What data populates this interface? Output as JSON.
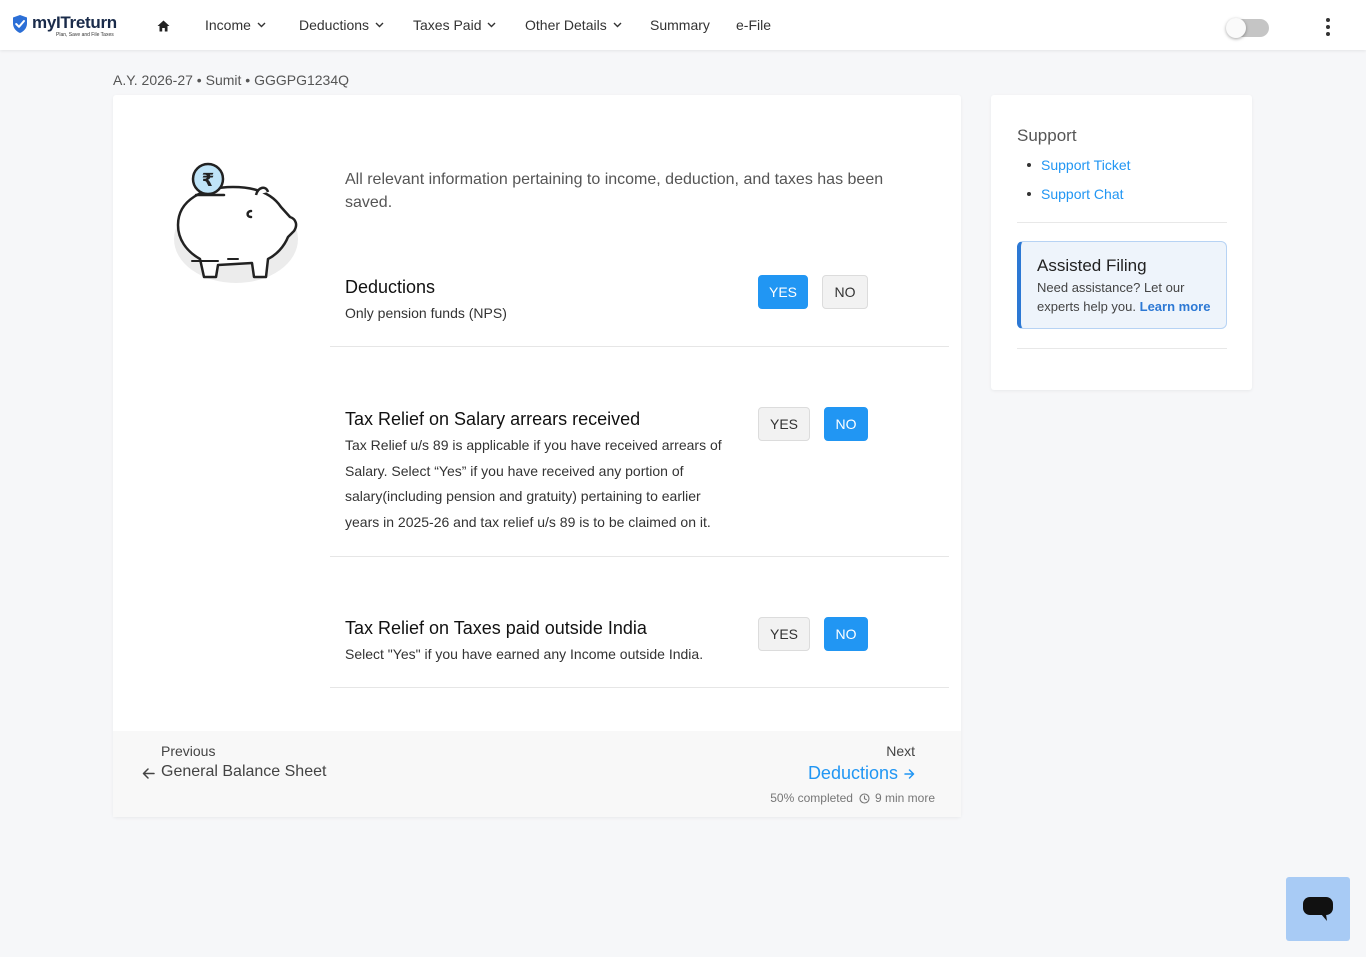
{
  "brand": {
    "name": "myITreturn",
    "tagline": "Plan, Save and File Taxes",
    "accent": "#2196f3"
  },
  "nav": {
    "home_icon": "home-icon",
    "items": [
      {
        "label": "Income",
        "dropdown": true
      },
      {
        "label": "Deductions",
        "dropdown": true
      },
      {
        "label": "Taxes Paid",
        "dropdown": true
      },
      {
        "label": "Other Details",
        "dropdown": true
      },
      {
        "label": "Summary",
        "dropdown": false
      },
      {
        "label": "e-File",
        "dropdown": false
      }
    ],
    "toggle_on": false,
    "menu_icon": "more-vertical-icon"
  },
  "breadcrumb": "A.Y. 2026-27 • Sumit • GGGPG1234Q",
  "main": {
    "saved_message": "All relevant information pertaining to income, deduction, and taxes has been saved.",
    "sections": [
      {
        "title": "Deductions",
        "description": "Only pension funds (NPS)",
        "yes_label": "YES",
        "no_label": "NO",
        "selected": "yes"
      },
      {
        "title": "Tax Relief on Salary arrears received",
        "description": "Tax Relief u/s 89 is applicable if you have received arrears of Salary. Select “Yes” if you have received any portion of salary(including pension and gratuity) pertaining to earlier years in 2025-26 and tax relief u/s 89 is to be claimed on it.",
        "yes_label": "YES",
        "no_label": "NO",
        "selected": "no"
      },
      {
        "title": "Tax Relief on Taxes paid outside India",
        "description": "Select \"Yes\" if you have earned any Income outside India.",
        "yes_label": "YES",
        "no_label": "NO",
        "selected": "no"
      }
    ]
  },
  "footer": {
    "previous_label": "Previous",
    "previous_page": "General Balance Sheet",
    "next_label": "Next",
    "next_page": "Deductions",
    "progress_text": "50% completed",
    "progress_percent": 50,
    "time_remaining": "9 min more"
  },
  "sidebar": {
    "support_title": "Support",
    "support_links": [
      "Support Ticket",
      "Support Chat"
    ],
    "assisted": {
      "title": "Assisted Filing",
      "description": "Need assistance? Let our experts help you.",
      "link": "Learn more"
    }
  }
}
